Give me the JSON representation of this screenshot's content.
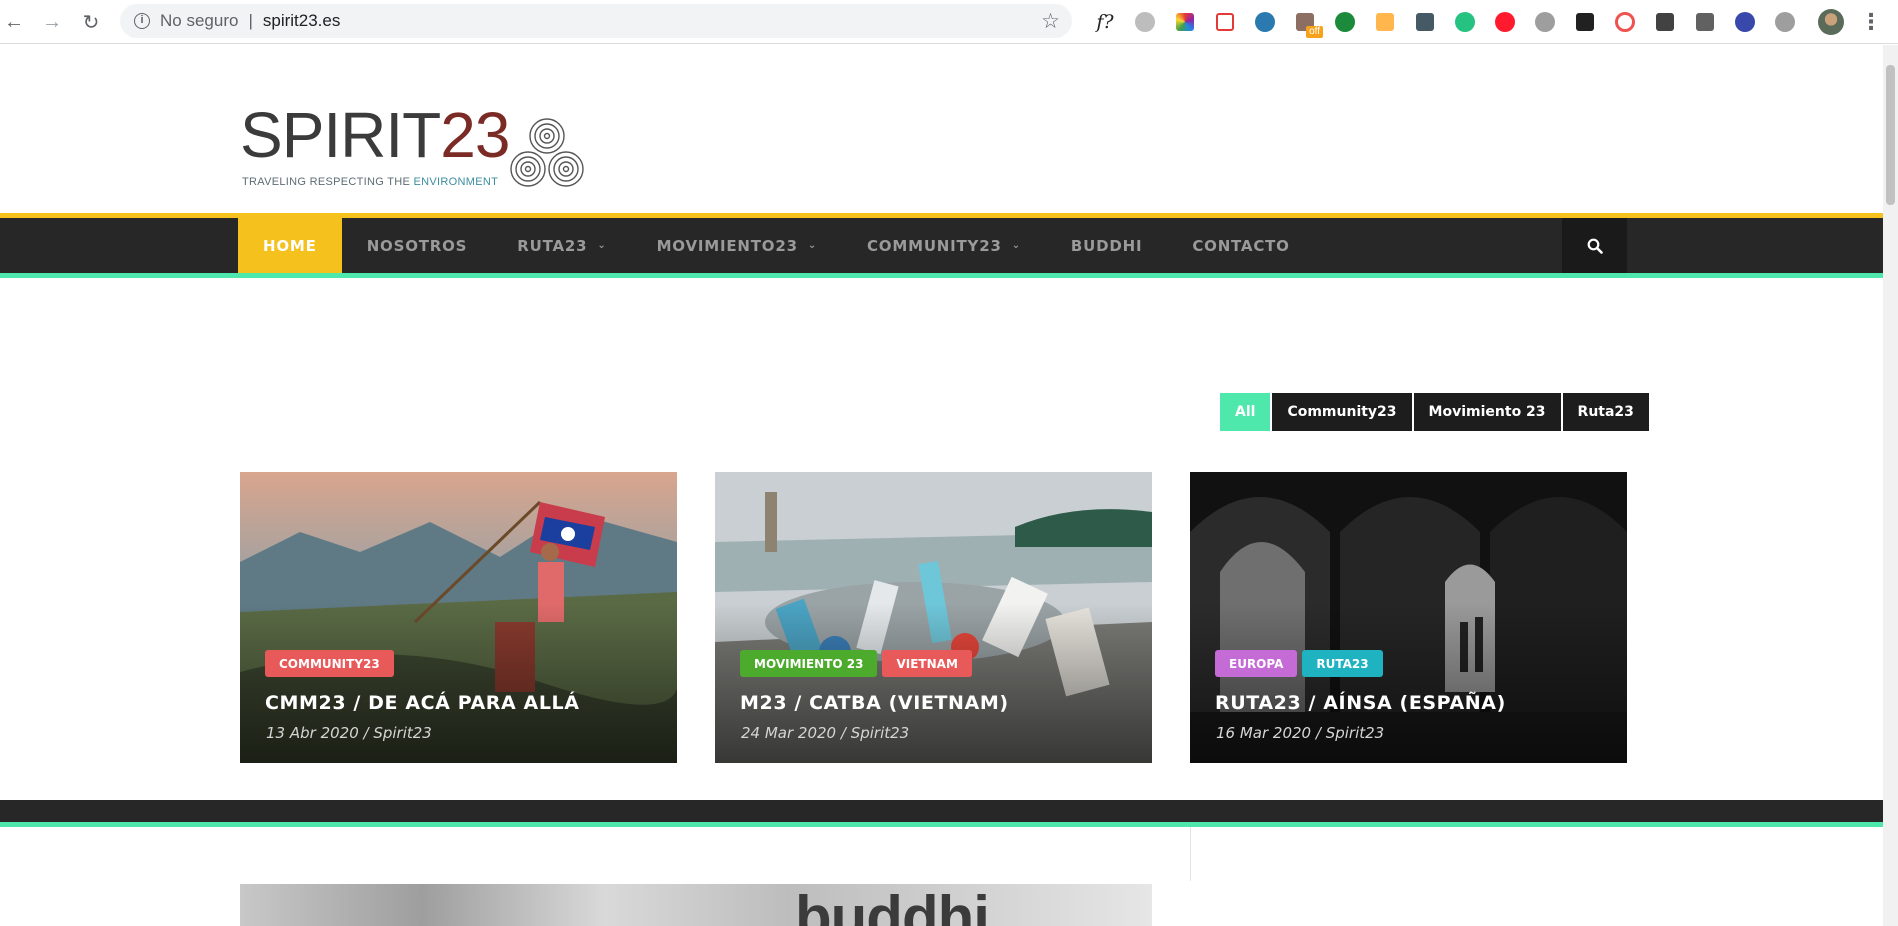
{
  "browser": {
    "insecure_label": "No seguro",
    "url": "spirit23.es",
    "ext_badge": "off"
  },
  "site": {
    "logo_word": "SPIRIT",
    "logo_num": "23",
    "tagline_main": "TRAVELING RESPECTING THE ",
    "tagline_env": "ENVIRONMENT"
  },
  "nav": {
    "items": [
      {
        "label": "HOME"
      },
      {
        "label": "NOSOTROS"
      },
      {
        "label": "RUTA23"
      },
      {
        "label": "MOVIMIENTO23"
      },
      {
        "label": "COMMUNITY23"
      },
      {
        "label": "BUDDHI"
      },
      {
        "label": "CONTACTO"
      }
    ]
  },
  "filters": [
    "All",
    "Community23",
    "Movimiento 23",
    "Ruta23"
  ],
  "posts": [
    {
      "tags": [
        {
          "label": "COMMUNITY23",
          "color": "#e85a5a"
        }
      ],
      "title": "CMM23 / DE ACÁ PARA ALLÁ",
      "meta": "13 Abr 2020  /  Spirit23"
    },
    {
      "tags": [
        {
          "label": "MOVIMIENTO 23",
          "color": "#4caa2c"
        },
        {
          "label": "VIETNAM",
          "color": "#e85a5a"
        }
      ],
      "title": "M23 / CATBA (VIETNAM)",
      "meta": "24 Mar 2020  /  Spirit23"
    },
    {
      "tags": [
        {
          "label": "EUROPA",
          "color": "#c46bd6"
        },
        {
          "label": "RUTA23",
          "color": "#1fb2c0"
        }
      ],
      "title": "RUTA23 / AÍNSA (ESPAÑA)",
      "meta": "16 Mar 2020  /  Spirit23"
    }
  ],
  "banner": {
    "word": "buddhi"
  },
  "colors": {
    "accent_yellow": "#f5c11c",
    "accent_green": "#4ee8ac",
    "nav_bg": "#272727"
  }
}
